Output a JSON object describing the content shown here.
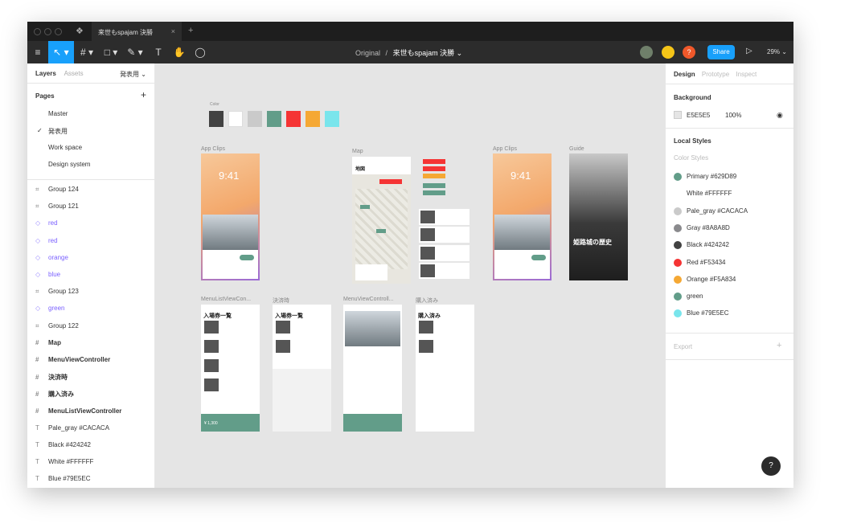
{
  "titlebar": {
    "tab_title": "来世もspajam 決勝",
    "tab_close": "×",
    "tab_add": "+"
  },
  "toolbar": {
    "breadcrumb_parent": "Original",
    "breadcrumb_sep": "/",
    "breadcrumb_current": "来世もspajam 決勝",
    "share_label": "Share",
    "zoom": "29%",
    "avatar3_label": "?"
  },
  "left_panel": {
    "tab_layers": "Layers",
    "tab_assets": "Assets",
    "current_page": "発表用",
    "pages_heading": "Pages",
    "pages": [
      "Master",
      "発表用",
      "Work space",
      "Design system"
    ],
    "layers": [
      {
        "icon": "⌗",
        "name": "Group 124",
        "style": ""
      },
      {
        "icon": "⌗",
        "name": "Group 121",
        "style": ""
      },
      {
        "icon": "◇",
        "name": "red",
        "style": "purple"
      },
      {
        "icon": "◇",
        "name": "red",
        "style": "purple"
      },
      {
        "icon": "◇",
        "name": "orange",
        "style": "purple"
      },
      {
        "icon": "◇",
        "name": "blue",
        "style": "purple"
      },
      {
        "icon": "⌗",
        "name": "Group 123",
        "style": ""
      },
      {
        "icon": "◇",
        "name": "green",
        "style": "purple"
      },
      {
        "icon": "⌗",
        "name": "Group 122",
        "style": ""
      },
      {
        "icon": "#",
        "name": "Map",
        "style": "bold"
      },
      {
        "icon": "#",
        "name": "MenuViewController",
        "style": "bold"
      },
      {
        "icon": "#",
        "name": "決済時",
        "style": "bold"
      },
      {
        "icon": "#",
        "name": "購入済み",
        "style": "bold"
      },
      {
        "icon": "#",
        "name": "MenuListViewController",
        "style": "bold"
      },
      {
        "icon": "T",
        "name": "Pale_gray #CACACA",
        "style": ""
      },
      {
        "icon": "T",
        "name": "Black #424242",
        "style": ""
      },
      {
        "icon": "T",
        "name": "White #FFFFFF",
        "style": ""
      },
      {
        "icon": "T",
        "name": "Blue #79E5EC",
        "style": ""
      }
    ]
  },
  "right_panel": {
    "tab_design": "Design",
    "tab_prototype": "Prototype",
    "tab_inspect": "Inspect",
    "background_title": "Background",
    "background_hex": "E5E5E5",
    "background_opacity": "100%",
    "local_styles_title": "Local Styles",
    "color_styles_title": "Color Styles",
    "export_title": "Export",
    "styles": [
      {
        "name": "Primary #629D89",
        "color": "#629D89"
      },
      {
        "name": "White #FFFFFF",
        "color": "#FFFFFF"
      },
      {
        "name": "Pale_gray #CACACA",
        "color": "#CACACA"
      },
      {
        "name": "Gray #8A8A8D",
        "color": "#8A8A8D"
      },
      {
        "name": "Black #424242",
        "color": "#424242"
      },
      {
        "name": "Red #F53434",
        "color": "#F53434"
      },
      {
        "name": "Orange #F5A834",
        "color": "#F5A834"
      },
      {
        "name": "green",
        "color": "#629D89"
      },
      {
        "name": "Blue #79E5EC",
        "color": "#79E5EC"
      }
    ]
  },
  "canvas": {
    "color_label": "Color",
    "frames": {
      "app_clips_1": "App Clips",
      "map": "Map",
      "app_clips_2": "App Clips",
      "guide": "Guide",
      "menu_list": "MenuListViewCon...",
      "payment": "決済時",
      "menu_view": "MenuViewControll...",
      "purchased": "購入済み"
    },
    "time": "9:41",
    "map_title": "地図",
    "guide_title": "姫路城の歴史",
    "ticket_list_title": "入場券一覧",
    "purchased_title": "購入済み",
    "price": "¥ 1,300",
    "palette": [
      "#424242",
      "#FFFFFF",
      "#CACACA",
      "#629D89",
      "#F53434",
      "#F5A834",
      "#79E5EC"
    ]
  },
  "help_label": "?"
}
